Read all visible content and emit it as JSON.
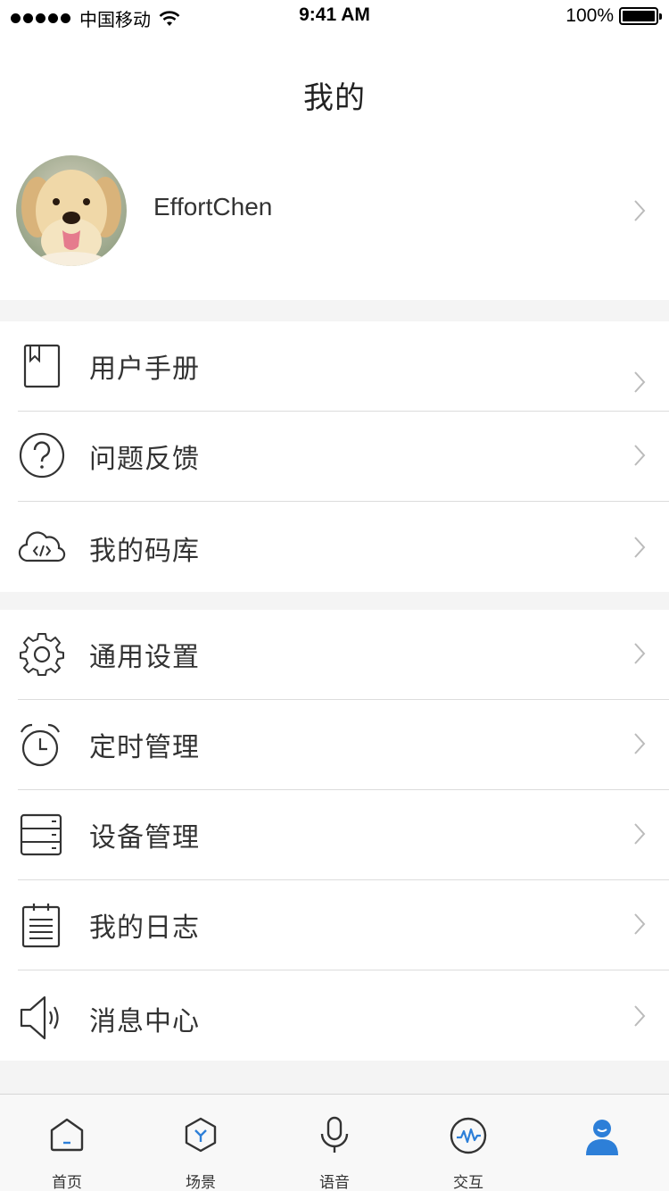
{
  "status_bar": {
    "carrier": "中国移动",
    "time": "9:41 AM",
    "battery": "100%"
  },
  "page": {
    "title": "我的"
  },
  "profile": {
    "username": "EffortChen"
  },
  "menu_sections": [
    [
      {
        "id": "manual",
        "label": "用户手册",
        "icon": "book-icon"
      },
      {
        "id": "feedback",
        "label": "问题反馈",
        "icon": "question-icon"
      },
      {
        "id": "code-lib",
        "label": "我的码库",
        "icon": "cloud-code-icon"
      }
    ],
    [
      {
        "id": "settings",
        "label": "通用设置",
        "icon": "gear-icon"
      },
      {
        "id": "timer",
        "label": "定时管理",
        "icon": "alarm-clock-icon"
      },
      {
        "id": "devices",
        "label": "设备管理",
        "icon": "server-icon"
      },
      {
        "id": "logs",
        "label": "我的日志",
        "icon": "notepad-icon"
      },
      {
        "id": "messages",
        "label": "消息中心",
        "icon": "speaker-icon"
      }
    ]
  ],
  "tab_bar": {
    "tabs": [
      {
        "label": "首页",
        "icon": "home-icon"
      },
      {
        "label": "场景",
        "icon": "scene-hexagon-icon"
      },
      {
        "label": "语音",
        "icon": "microphone-icon"
      },
      {
        "label": "交互",
        "icon": "interaction-icon"
      },
      {
        "label": "",
        "icon": "user-icon",
        "active": true
      }
    ]
  },
  "colors": {
    "accent": "#2d7fd8",
    "section_gap": "#f4f4f4",
    "divider": "#dcdcdc"
  }
}
